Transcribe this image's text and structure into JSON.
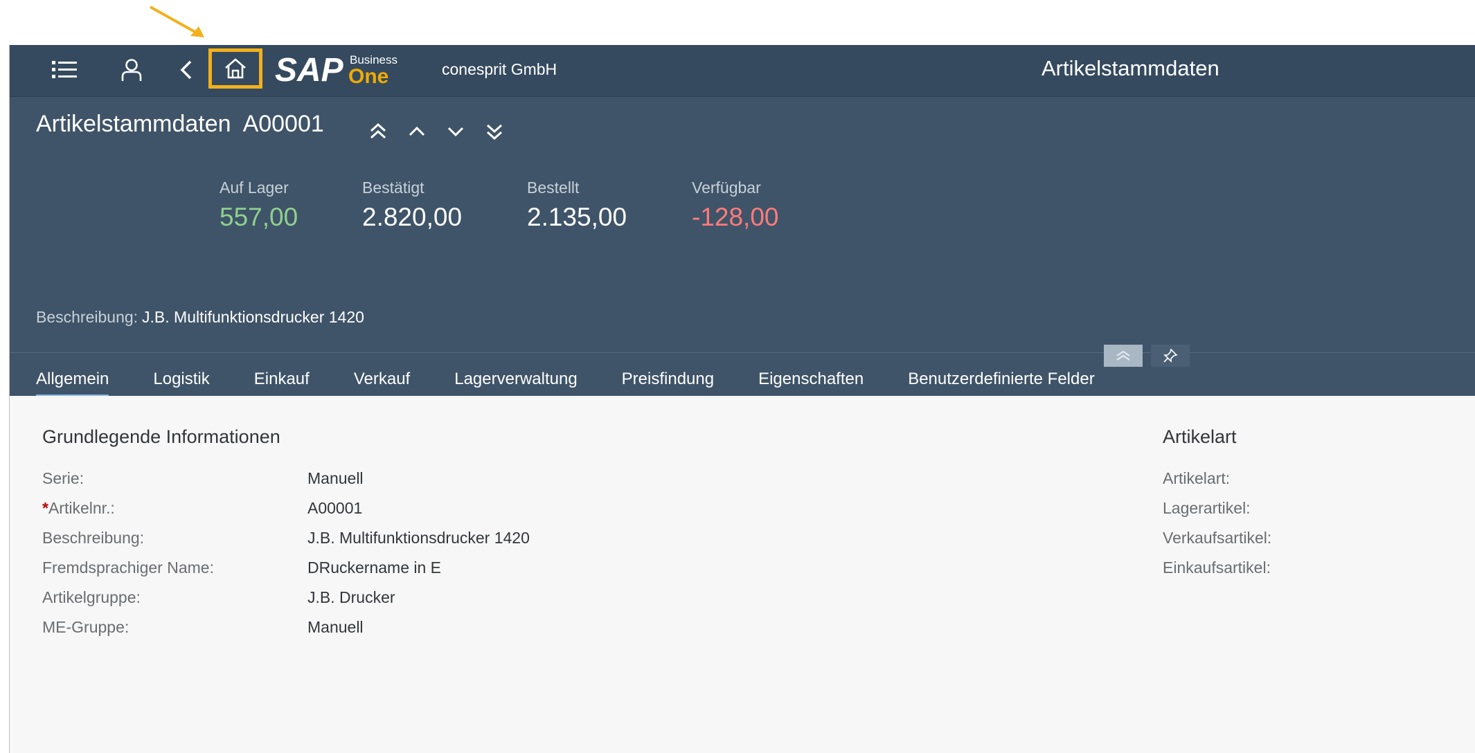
{
  "colors": {
    "shellbar_bg": "#354a5f",
    "header_bg": "#3f5468",
    "highlight": "#f2b11c",
    "positive": "#8fd18f",
    "negative": "#ff7b7b",
    "logo_accent": "#f0ab00"
  },
  "shell": {
    "menu_icon": "list-icon",
    "user_icon": "user-icon",
    "back_icon": "chevron-left-icon",
    "home_icon": "home-icon",
    "logo_text": "SAP",
    "logo_small": "Business",
    "logo_big": "One",
    "company": "conesprit GmbH",
    "app_title": "Artikelstammdaten"
  },
  "header": {
    "title": "Artikelstammdaten  A00001",
    "kpis": [
      {
        "label": "Auf Lager",
        "value": "557,00"
      },
      {
        "label": "Bestätigt",
        "value": "2.820,00"
      },
      {
        "label": "Bestellt",
        "value": "2.135,00"
      },
      {
        "label": "Verfügbar",
        "value": "-128,00"
      }
    ],
    "description_label": "Beschreibung:",
    "description_value": "J.B. Multifunktionsdrucker 1420"
  },
  "tabs": [
    {
      "label": "Allgemein",
      "active": true
    },
    {
      "label": "Logistik"
    },
    {
      "label": "Einkauf"
    },
    {
      "label": "Verkauf"
    },
    {
      "label": "Lagerverwaltung"
    },
    {
      "label": "Preisfindung"
    },
    {
      "label": "Eigenschaften"
    },
    {
      "label": "Benutzerdefinierte Felder"
    }
  ],
  "general": {
    "title": "Grundlegende Informationen",
    "fields": [
      {
        "label": "Serie:",
        "value": "Manuell"
      },
      {
        "label": "Artikelnr.:",
        "value": "A00001",
        "required": "*"
      },
      {
        "label": "Beschreibung:",
        "value": "J.B. Multifunktionsdrucker 1420"
      },
      {
        "label": "Fremdsprachiger Name:",
        "value": "DRuckername in E"
      },
      {
        "label": "Artikelgruppe:",
        "value": "J.B. Drucker"
      },
      {
        "label": "ME-Gruppe:",
        "value": "Manuell"
      }
    ]
  },
  "item_type": {
    "title": "Artikelart",
    "fields": [
      {
        "label": "Artikelart:"
      },
      {
        "label": "Lagerartikel:"
      },
      {
        "label": "Verkaufsartikel:"
      },
      {
        "label": "Einkaufsartikel:"
      }
    ]
  }
}
